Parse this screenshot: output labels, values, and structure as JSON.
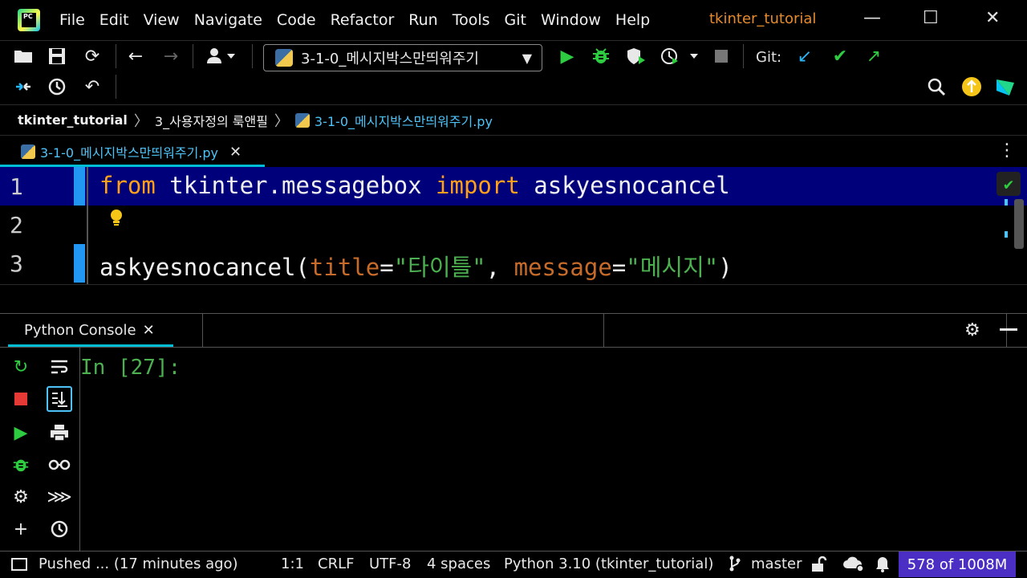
{
  "app": {
    "logo_text": "PC",
    "project_title": "tkinter_tutorial"
  },
  "menu": [
    {
      "label": "File"
    },
    {
      "label": "Edit"
    },
    {
      "label": "View"
    },
    {
      "label": "Navigate"
    },
    {
      "label": "Code"
    },
    {
      "label": "Refactor"
    },
    {
      "label": "Run"
    },
    {
      "label": "Tools"
    },
    {
      "label": "Git"
    },
    {
      "label": "Window"
    },
    {
      "label": "Help"
    }
  ],
  "toolbar": {
    "run_config": "3-1-0_메시지박스만띄워주기",
    "git_label": "Git:"
  },
  "breadcrumb": {
    "project": "tkinter_tutorial",
    "folder": "3_사용자정의 룩앤필",
    "file": "3-1-0_메시지박스만띄워주기.py"
  },
  "editor": {
    "tab_label": "3-1-0_메시지박스만띄워주기.py",
    "lines": [
      {
        "number": "1"
      },
      {
        "number": "2"
      },
      {
        "number": "3"
      }
    ],
    "line1": {
      "kw1": "from",
      "mod": " tkinter.messagebox ",
      "kw2": "import",
      "name": " askyesnocancel"
    },
    "line3": {
      "fn": "askyesnocancel(",
      "p1": "title",
      "eq1": "=",
      "s1": "\"타이틀\"",
      "comma": ", ",
      "p2": "message",
      "eq2": "=",
      "s2": "\"메시지\"",
      "close": ")"
    }
  },
  "console": {
    "tab_label": "Python Console",
    "prompt": "In [27]:"
  },
  "statusbar": {
    "message": "Pushed ... (17 minutes ago)",
    "position": "1:1",
    "line_sep": "CRLF",
    "encoding": "UTF-8",
    "indent": "4 spaces",
    "interpreter": "Python 3.10 (tkinter_tutorial)",
    "branch": "master",
    "memory": "578 of 1008M"
  },
  "colors": {
    "current_line": "#00007a",
    "keyword": "#ff9f1a",
    "string": "#4caf50",
    "accent": "#00bcd4",
    "memory_bg": "#4b2ec4"
  }
}
